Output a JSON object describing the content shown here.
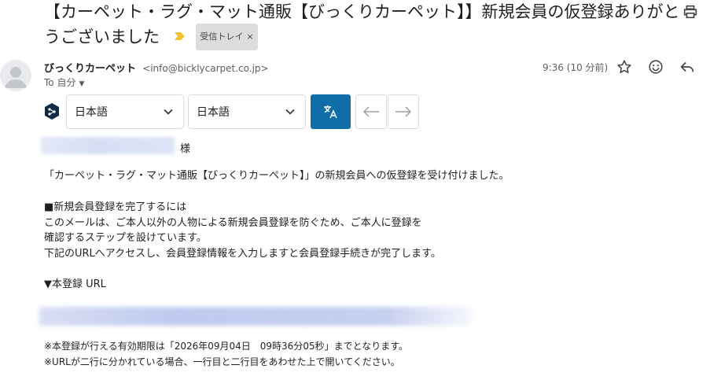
{
  "subject": {
    "title": "【カーペット・ラグ・マット通販【びっくりカーペット】】新規会員の仮登録ありがとうございました",
    "label": "受信トレイ",
    "label_remove": "×",
    "importance_icon": "importance-marker-icon",
    "print_icon": "print-icon"
  },
  "sender": {
    "name": "びっくりカーペット",
    "email": "<info@bicklycarpet.co.jp>",
    "to": "To 自分",
    "to_caret": "▼",
    "time": "9:36 (10 分前)",
    "avatar_icon": "person-avatar-icon"
  },
  "actions": {
    "star_icon": "star-icon",
    "emoji_icon": "emoji-icon",
    "reply_icon": "reply-icon"
  },
  "translate": {
    "source_lang": "日本語",
    "target_lang": "日本語",
    "translate_icon": "translate-icon",
    "back_icon": "arrow-left-icon",
    "forward_icon": "arrow-right-icon",
    "accent": "#0f6ea8"
  },
  "body": {
    "honorific": "様",
    "intro": "「カーペット・ラグ・マット通販【びっくりカーペット】」の新規会員への仮登録を受け付けました。",
    "section_heading": "■新規会員登録を完了するには",
    "para1": "このメールは、ご本人以外の人物による新規会員登録を防ぐため、ご本人に登録を",
    "para2": "確認するステップを設けています。",
    "para3": "下記のURLへアクセスし、会員登録情報を入力しますと会員登録手続きが完了します。",
    "url_heading": "▼本登録 URL",
    "note1": "※本登録が行える有効期限は「2026年09月04日　09時36分05秒」までとなります。",
    "note2": "※URLが二行に分かれている場合、一行目と二行目をあわせた上で開いてください。"
  }
}
